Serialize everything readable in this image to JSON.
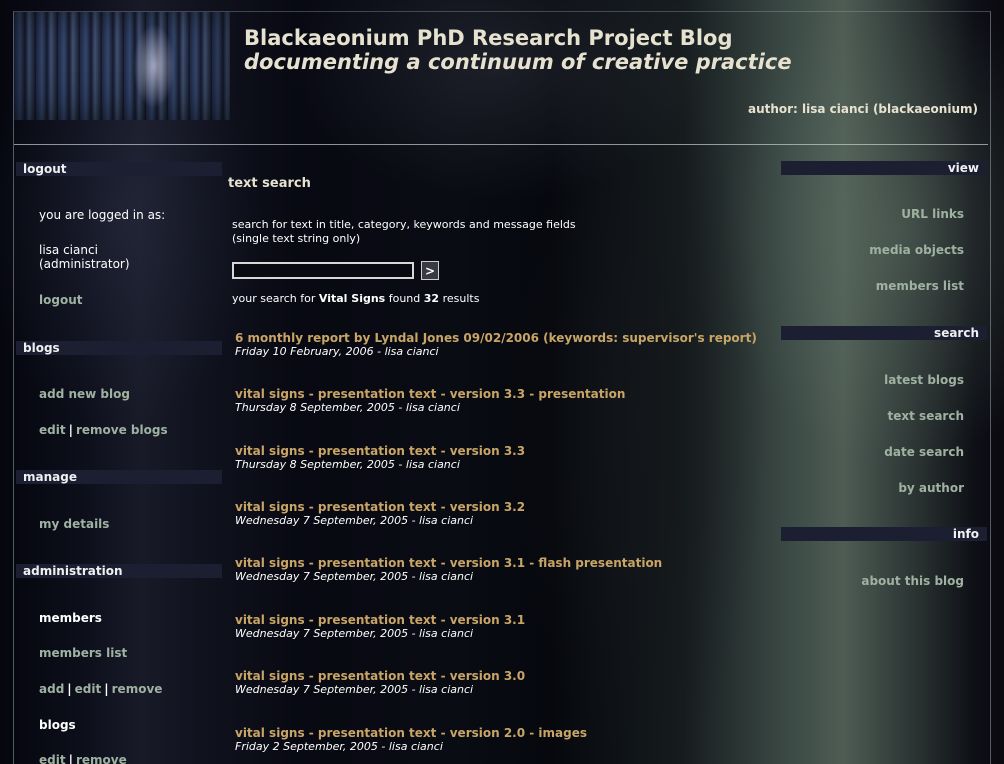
{
  "header": {
    "title": "Blackaeonium PhD Research Project Blog",
    "subtitle": "documenting a continuum of creative practice",
    "author": "author: lisa cianci (blackaeonium)"
  },
  "sidebar_left": {
    "logout_heading": "logout",
    "logged_in_as": "you are logged in as:",
    "user_name": "lisa cianci",
    "user_role": "(administrator)",
    "logout_link": "logout",
    "blogs_heading": "blogs",
    "add_new_blog": "add new blog",
    "edit_blogs": "edit",
    "remove_blogs": "remove blogs",
    "manage_heading": "manage",
    "my_details": "my details",
    "administration_heading": "administration",
    "members_label": "members",
    "members_list": "members list",
    "add": "add",
    "edit": "edit",
    "remove": "remove",
    "blogs_label": "blogs",
    "blogs_edit": "edit",
    "blogs_remove": "remove",
    "separator": "|"
  },
  "sidebar_right": {
    "view_heading": "view",
    "url_links": "URL links",
    "media_objects": "media objects",
    "members_list": "members list",
    "search_heading": "search",
    "latest_blogs": "latest blogs",
    "text_search": "text search",
    "date_search": "date search",
    "by_author": "by author",
    "info_heading": "info",
    "about_this_blog": "about this blog"
  },
  "main": {
    "title": "text search",
    "description_line1": "search for text in title, category, keywords and message fields",
    "description_line2": "(single text string only)",
    "search_value": "",
    "search_button": ">",
    "summary_prefix": "your search for",
    "query": "Vital Signs",
    "summary_middle": "found",
    "count": "32",
    "summary_suffix": "results",
    "results": [
      {
        "title": "6 monthly report by Lyndal Jones 09/02/2006 (keywords: supervisor's report)",
        "meta": "Friday 10 February, 2006 - lisa cianci"
      },
      {
        "title": "vital signs - presentation text - version 3.3 - presentation",
        "meta": "Thursday 8 September, 2005 - lisa cianci"
      },
      {
        "title": "vital signs - presentation text - version 3.3",
        "meta": "Thursday 8 September, 2005 - lisa cianci"
      },
      {
        "title": "vital signs - presentation text - version 3.2",
        "meta": "Wednesday 7 September, 2005 - lisa cianci"
      },
      {
        "title": "vital signs - presentation text - version 3.1 - flash presentation",
        "meta": "Wednesday 7 September, 2005 - lisa cianci"
      },
      {
        "title": "vital signs - presentation text - version 3.1",
        "meta": "Wednesday 7 September, 2005 - lisa cianci"
      },
      {
        "title": "vital signs - presentation text - version 3.0",
        "meta": "Wednesday 7 September, 2005 - lisa cianci"
      },
      {
        "title": "vital signs - presentation text - version 2.0 - images",
        "meta": "Friday 2 September, 2005 - lisa cianci"
      }
    ]
  },
  "colors": {
    "link": "#9fb2a1",
    "result_title": "#c8a566",
    "heading_bar": "#1c1e32",
    "header_text": "#e6e2cf"
  }
}
